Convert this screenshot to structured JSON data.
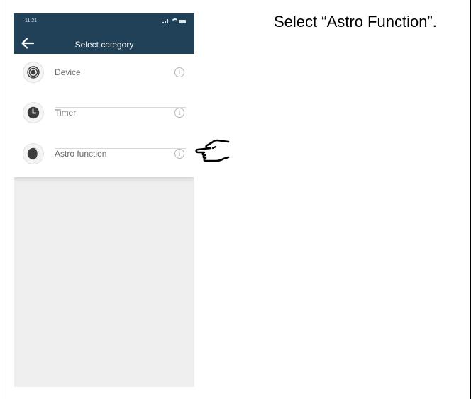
{
  "status_bar": {
    "time": "11:21"
  },
  "appbar": {
    "title": "Select category",
    "back_icon": "arrow-left-icon"
  },
  "categories": [
    {
      "label": "Device",
      "icon": "device-icon",
      "info": "i"
    },
    {
      "label": "Timer",
      "icon": "clock-icon",
      "info": "i"
    },
    {
      "label": "Astro function",
      "icon": "half-moon-icon",
      "info": "i"
    }
  ],
  "instruction": {
    "text": "Select “Astro Function”."
  },
  "colors": {
    "appbar": "#214158",
    "background": "#efefef",
    "label": "#6a6a6a",
    "icon_dark": "#3c3c3c"
  }
}
